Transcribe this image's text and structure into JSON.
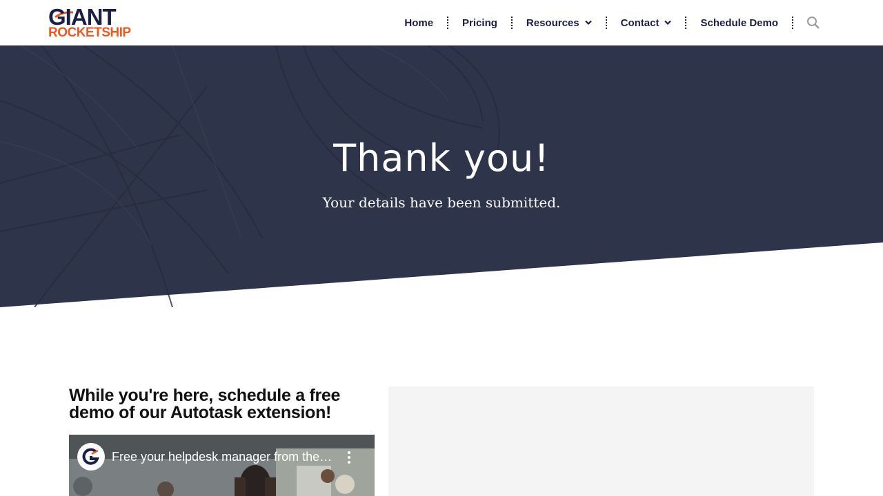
{
  "brand": {
    "name_top": "GIANT",
    "name_bottom": "ROCKETSHIP",
    "color_navy": "#1b1f45",
    "color_orange": "#ea5a22"
  },
  "nav": {
    "items": [
      {
        "label": "Home",
        "has_dropdown": false
      },
      {
        "label": "Pricing",
        "has_dropdown": false
      },
      {
        "label": "Resources",
        "has_dropdown": true
      },
      {
        "label": "Contact",
        "has_dropdown": true
      },
      {
        "label": "Schedule Demo",
        "has_dropdown": false
      }
    ],
    "search_icon": "search-icon",
    "chevron_icon": "chevron-down-icon"
  },
  "hero": {
    "title": "Thank you!",
    "subtitle": "Your details have been submitted.",
    "background_color": "#2e3449"
  },
  "promo": {
    "heading": "While you're here, schedule a free demo of our Autotask extension!"
  },
  "video": {
    "title": "Free your helpdesk manager from the ...",
    "channel_icon": "giant-rocketship-channel-icon",
    "menu_icon": "more-vertical-icon"
  },
  "form_panel": {
    "background_color": "#f4f4f4"
  }
}
